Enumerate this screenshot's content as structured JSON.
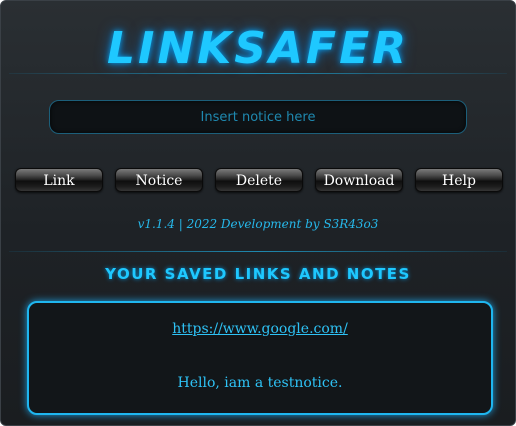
{
  "app": {
    "logo_text": "LINKSAFER"
  },
  "input": {
    "placeholder": "Insert notice here",
    "value": ""
  },
  "buttons": {
    "link": "Link",
    "notice": "Notice",
    "delete": "Delete",
    "download": "Download",
    "help": "Help"
  },
  "version_text": "v1.1.4 | 2022 Development by S3R43o3",
  "saved": {
    "title": "YOUR SAVED LINKS AND NOTES",
    "items": [
      {
        "type": "link",
        "text": "https://www.google.com/"
      },
      {
        "type": "note",
        "text": "Hello, iam a testnotice."
      }
    ]
  },
  "colors": {
    "accent": "#1ec8ff",
    "background": "#1e2226",
    "text": "#2ec2f5"
  }
}
